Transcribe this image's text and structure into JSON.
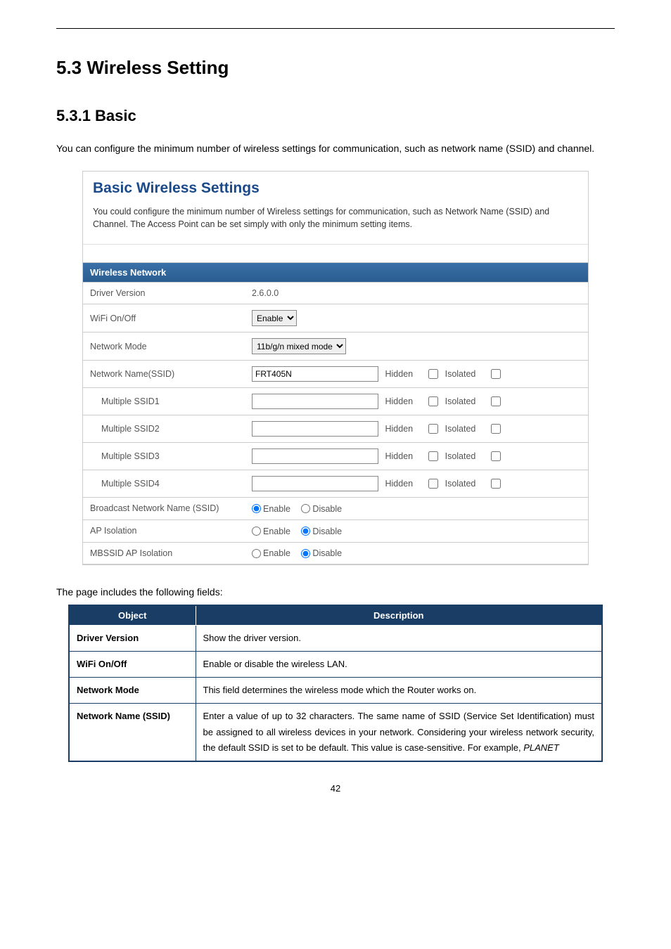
{
  "heading1": "5.3 Wireless Setting",
  "heading2": "5.3.1 Basic",
  "intro": "You can configure the minimum number of wireless settings for communication, such as network name (SSID) and channel.",
  "panel": {
    "title": "Basic Wireless Settings",
    "desc": "You could configure the minimum number of Wireless settings for communication, such as Network Name (SSID) and Channel. The Access Point can be set simply with only the minimum setting items.",
    "section_header": "Wireless Network",
    "rows": {
      "driver_version": {
        "label": "Driver Version",
        "value": "2.6.0.0"
      },
      "wifi_onoff": {
        "label": "WiFi On/Off",
        "select_value": "Enable"
      },
      "network_mode": {
        "label": "Network Mode",
        "select_value": "11b/g/n mixed mode"
      },
      "ssid_main": {
        "label": "Network Name(SSID)",
        "value": "FRT405N",
        "hidden_label": "Hidden",
        "isolated_label": "Isolated"
      },
      "ssid1": {
        "label": "Multiple SSID1",
        "value": "",
        "hidden_label": "Hidden",
        "isolated_label": "Isolated"
      },
      "ssid2": {
        "label": "Multiple SSID2",
        "value": "",
        "hidden_label": "Hidden",
        "isolated_label": "Isolated"
      },
      "ssid3": {
        "label": "Multiple SSID3",
        "value": "",
        "hidden_label": "Hidden",
        "isolated_label": "Isolated"
      },
      "ssid4": {
        "label": "Multiple SSID4",
        "value": "",
        "hidden_label": "Hidden",
        "isolated_label": "Isolated"
      },
      "broadcast": {
        "label": "Broadcast Network Name (SSID)",
        "enable": "Enable",
        "disable": "Disable",
        "selected": "enable"
      },
      "ap_isolation": {
        "label": "AP Isolation",
        "enable": "Enable",
        "disable": "Disable",
        "selected": "disable"
      },
      "mbssid": {
        "label": "MBSSID AP Isolation",
        "enable": "Enable",
        "disable": "Disable",
        "selected": "disable"
      }
    }
  },
  "fields_intro": "The page includes the following fields:",
  "desc_table": {
    "headers": {
      "object": "Object",
      "description": "Description"
    },
    "rows": [
      {
        "object": "Driver Version",
        "description": "Show the driver version."
      },
      {
        "object": "WiFi On/Off",
        "description": "Enable or disable the wireless LAN."
      },
      {
        "object": "Network Mode",
        "description": "This field determines the wireless mode which the Router works on."
      },
      {
        "object": "Network Name (SSID)",
        "description_pre": "Enter a value of up to 32 characters. The same name of SSID (Service Set Identification) must be assigned to all wireless devices in your network. Considering your wireless network security, the default SSID is set to be default. This value is case-sensitive. For example, ",
        "description_italic": "PLANET"
      }
    ]
  },
  "page_number": "42"
}
